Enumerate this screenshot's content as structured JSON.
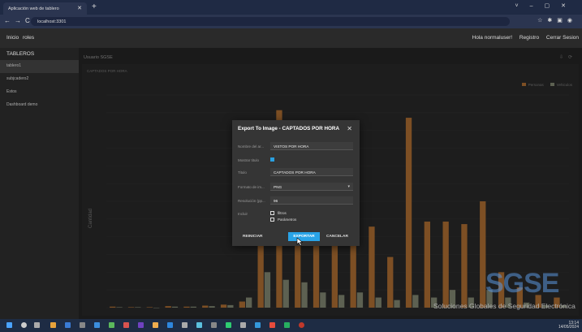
{
  "browser": {
    "tab_title": "Aplicación web de tablero",
    "url": "localhost:3301"
  },
  "appbar": {
    "nav_left": "Inicio  roles",
    "greeting": "Hola normaluser!",
    "register": "Registro",
    "logout": "Cerrar Sesion"
  },
  "sidebar": {
    "heading": "TABLEROS",
    "items": [
      {
        "label": "tablero1"
      },
      {
        "label": "subjcadero2"
      },
      {
        "label": "Estos"
      },
      {
        "label": "Dashboard demo"
      }
    ]
  },
  "dashboard": {
    "title": "Usuario SGSE",
    "panel_title": "CAPTADOS POR HORA"
  },
  "chart_data": {
    "type": "bar",
    "ylabel": "Cantidad",
    "series": [
      {
        "name": "Personas",
        "color": "#c07a38",
        "values": [
          2,
          1,
          1,
          3,
          2,
          4,
          6,
          12,
          365,
          390,
          215,
          185,
          170,
          140,
          160,
          100,
          375,
          170,
          170,
          165,
          210,
          70,
          40,
          25,
          20
        ]
      },
      {
        "name": "Vehiculos",
        "color": "#8f957e",
        "values": [
          1,
          1,
          0,
          2,
          2,
          3,
          5,
          20,
          70,
          55,
          50,
          30,
          25,
          30,
          20,
          15,
          25,
          20,
          35,
          20,
          35,
          20,
          10,
          5,
          5
        ]
      }
    ],
    "ylim": [
      0,
      420
    ]
  },
  "dialog": {
    "title": "Export To Image - CAPTADOS POR HORA",
    "fields": {
      "filename_label": "Nombre del ar...",
      "filename_value": "VISTOS POR HORA",
      "show_title_label": "Mostrar titulo",
      "title_label": "Titulo",
      "title_value": "CAPTADOS POR HORA",
      "format_label": "Formato de im...",
      "format_value": "PNG",
      "resolution_label": "Resolución (pp...",
      "resolution_value": "96",
      "include_label": "Incluir",
      "filters_label": "filtros",
      "params_label": "Parámetros"
    },
    "buttons": {
      "reset": "REINICIAR",
      "export": "EXPORTAR",
      "cancel": "CANCELAR"
    }
  },
  "watermark": {
    "logo": "SGSE",
    "subtitle": "Soluciones Globales de Seguridad Electrónica"
  },
  "taskbar": {
    "time": "13:14",
    "date": "14/05/2024"
  }
}
